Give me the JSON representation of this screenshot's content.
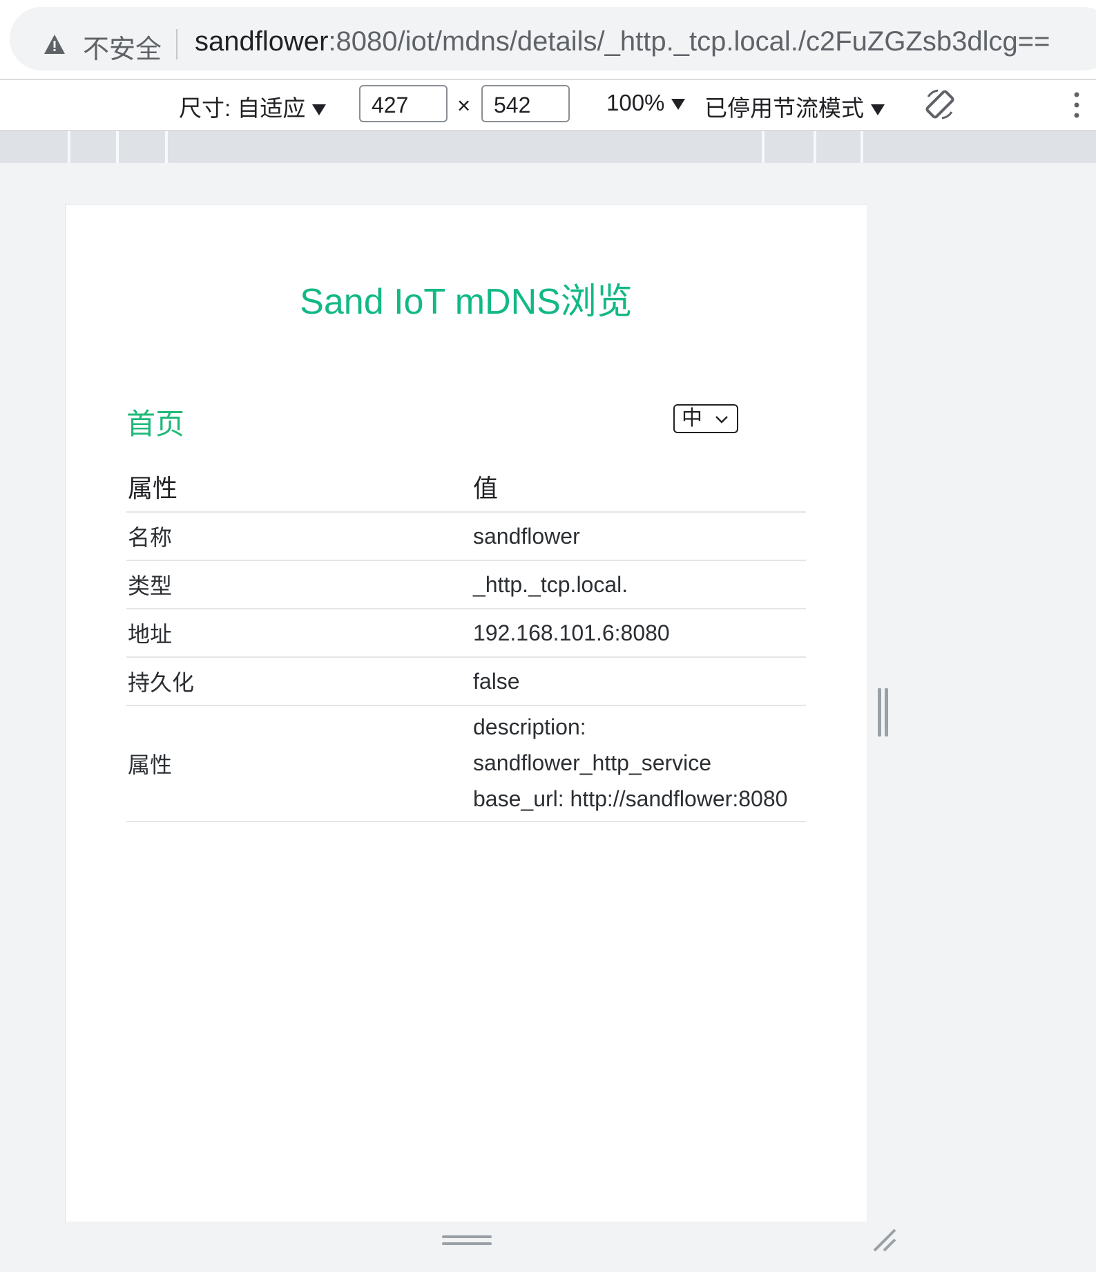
{
  "browser": {
    "security_label": "不安全",
    "url_host": "sandflower",
    "url_rest": ":8080/iot/mdns/details/_http._tcp.local./c2FuZGZsb3dlcg=="
  },
  "devtools": {
    "dimensions_label": "尺寸: 自适应",
    "width": "427",
    "times": "×",
    "height": "542",
    "zoom": "100%",
    "throttling": "已停用节流模式",
    "icons": [
      "warning-icon",
      "rotate-icon",
      "more-icon",
      "resize-corner-icon"
    ]
  },
  "page": {
    "title": "Sand IoT mDNS浏览",
    "home_link": "首页",
    "language": "中",
    "accent_color": "#12b886",
    "table": {
      "headers": [
        "属性",
        "值"
      ],
      "rows": [
        {
          "key": "名称",
          "value": "sandflower"
        },
        {
          "key": "类型",
          "value": "_http._tcp.local."
        },
        {
          "key": "地址",
          "value": "192.168.101.6:8080"
        },
        {
          "key": "持久化",
          "value": "false"
        }
      ],
      "properties_row": {
        "key": "属性",
        "lines": [
          "description:",
          "sandflower_http_service",
          "base_url: http://sandflower:8080"
        ]
      }
    }
  }
}
